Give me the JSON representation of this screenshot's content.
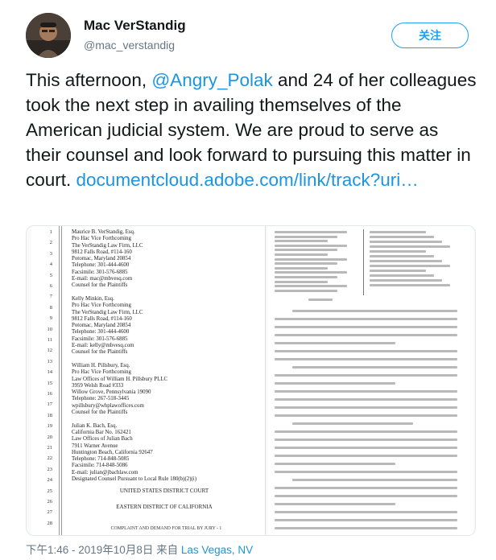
{
  "author": {
    "name": "Mac VerStandig",
    "handle": "@mac_verstandig",
    "follow_label": "关注"
  },
  "tweet": {
    "text_before": "This afternoon, ",
    "mention": "@Angry_Polak",
    "text_after": " and 24 of her colleagues took the next step in availing themselves of the American judicial system. We are proud to serve as their counsel and look forward to pursuing this matter in court. ",
    "link": "documentcloud.adobe.com/link/track?uri…"
  },
  "attachment": {
    "left_page": {
      "line_numbers": [
        "1",
        "2",
        "3",
        "4",
        "5",
        "6",
        "7",
        "8",
        "9",
        "10",
        "11",
        "12",
        "13",
        "14",
        "15",
        "16",
        "17",
        "18",
        "19",
        "20",
        "21",
        "22",
        "23",
        "24",
        "25",
        "26",
        "27",
        "28"
      ],
      "counsel_block": "Maurice B. VerStandig, Esq.\nPro Hac Vice Forthcoming\nThe VerStandig Law Firm, LLC\n9812 Falls Road, #114-160\nPotomac, Maryland 20854\nTelephone: 301-444-4600\nFacsimile: 301-576-6885\nE-mail: mac@mbvesq.com\nCounsel for the Plaintiffs\n\nKelly Minkin, Esq.\nPro Hac Vice Forthcoming\nThe VerStandig Law Firm, LLC\n9812 Falls Road, #114-160\nPotomac, Maryland 20854\nTelephone: 301-444-4600\nFacsimile: 301-576-6885\nE-mail: kelly@mbvesq.com\nCounsel for the Plaintiffs\n\nWilliam H. Pillsbury, Esq.\nPro Hac Vice Forthcoming\nLaw Offices of William H. Pillsbury PLLC\n3959 Welsh Road #333\nWillow Grove, Pennsylvania 19090\nTelephone: 267-518-3445\nwpillsbury@whplawoffices.com\nCounsel for the Plaintiffs\n\nJulian K. Bach, Esq.\nCalifornia Bar No. 162421\nLaw Offices of Julian Bach\n7911 Warner Avenue\nHuntington Beach, California 92647\nTelephone: 714-848-5085\nFacsimile: 714-848-5086\nE-mail: julian@jbachlaw.com\nDesignated Counsel Pursuant to Local Rule 180(b)(2)(i)",
      "court_name": "UNITED STATES DISTRICT COURT",
      "district": "EASTERN DISTRICT OF CALIFORNIA",
      "footer": "COMPLAINT AND DEMAND FOR TRIAL BY JURY - 1"
    }
  },
  "meta": {
    "time": "下午1:46 - 2019年10月8日",
    "location_prefix": "来自 ",
    "location": "Las Vegas, NV"
  }
}
